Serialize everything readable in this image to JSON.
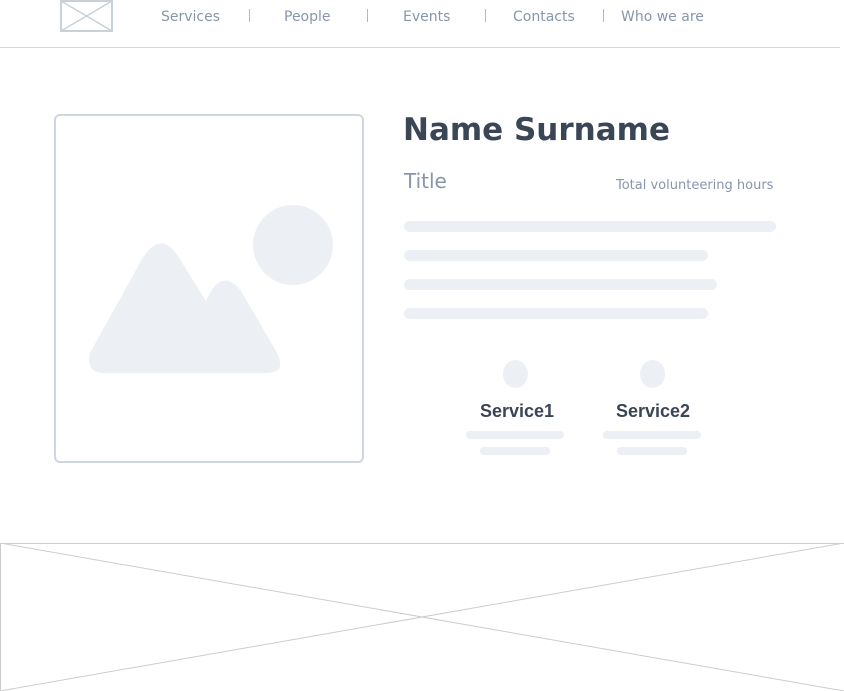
{
  "nav": {
    "items": [
      {
        "label": "Services"
      },
      {
        "label": "People"
      },
      {
        "label": "Events"
      },
      {
        "label": "Contacts"
      },
      {
        "label": "Who we are"
      }
    ]
  },
  "profile": {
    "name": "Name Surname",
    "title": "Title",
    "hours_label": "Total volunteering hours"
  },
  "services": [
    {
      "name": "Service1"
    },
    {
      "name": "Service2"
    }
  ],
  "colors": {
    "heading": "#3a4555",
    "muted": "#8796ab",
    "placeholder_fill": "#eceff3",
    "border": "#cfd6df"
  },
  "icons": {
    "logo": "logo-placeholder-icon",
    "photo": "image-placeholder-icon",
    "banner": "banner-placeholder-icon"
  }
}
